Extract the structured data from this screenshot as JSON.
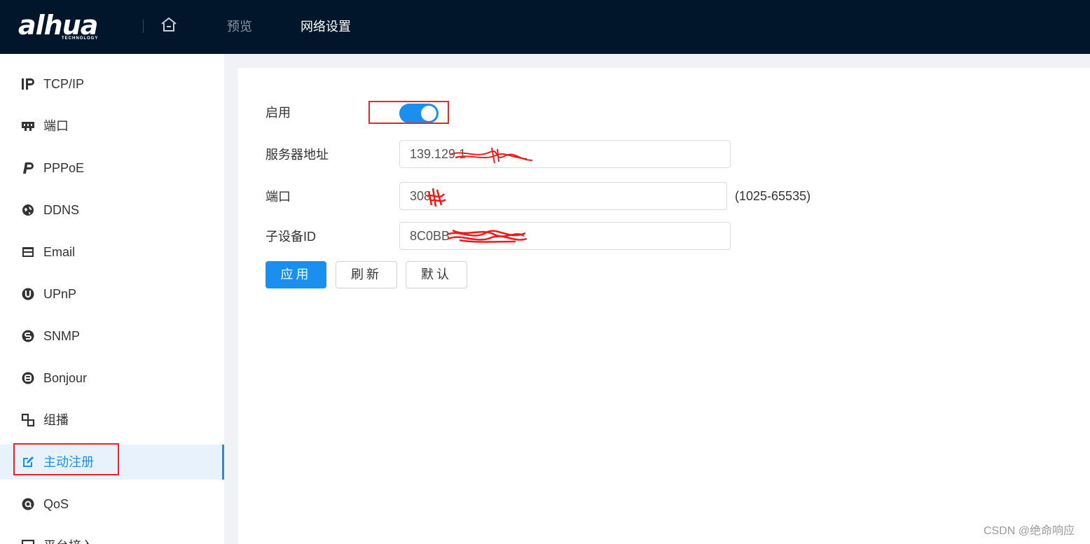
{
  "header": {
    "logo_text": "alhua",
    "logo_subtext": "TECHNOLOGY",
    "home_icon": "home-icon",
    "nav": [
      {
        "label": "预览"
      },
      {
        "label": "网络设置"
      }
    ]
  },
  "sidebar": {
    "items": [
      {
        "label": "TCP/IP",
        "icon": "ip-icon"
      },
      {
        "label": "端口",
        "icon": "port-icon"
      },
      {
        "label": "PPPoE",
        "icon": "pppoe-icon"
      },
      {
        "label": "DDNS",
        "icon": "globe-icon"
      },
      {
        "label": "Email",
        "icon": "email-icon"
      },
      {
        "label": "UPnP",
        "icon": "upnp-icon"
      },
      {
        "label": "SNMP",
        "icon": "snmp-icon"
      },
      {
        "label": "Bonjour",
        "icon": "bonjour-icon"
      },
      {
        "label": "组播",
        "icon": "multicast-icon"
      },
      {
        "label": "主动注册",
        "icon": "register-icon",
        "active": true
      },
      {
        "label": "QoS",
        "icon": "qos-icon"
      },
      {
        "label": "平台接入",
        "icon": "platform-icon"
      }
    ]
  },
  "form": {
    "enable_label": "启用",
    "enable_on": true,
    "server_label": "服务器地址",
    "server_value": "139.129.1",
    "port_label": "端口",
    "port_value": "308",
    "port_range": "(1025-65535)",
    "device_id_label": "子设备ID",
    "device_id_value": "8C0BB",
    "apply_label": "应用",
    "refresh_label": "刷新",
    "default_label": "默认"
  },
  "watermark": "CSDN @绝命响应",
  "colors": {
    "topbar": "#01162b",
    "accent": "#1a8ff0",
    "highlight_box": "#e8262a"
  }
}
